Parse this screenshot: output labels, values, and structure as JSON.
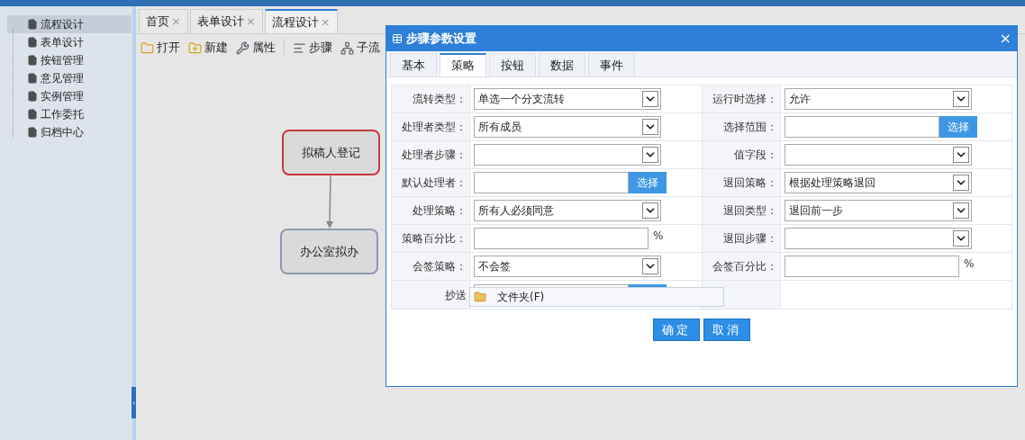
{
  "sidebar": {
    "items": [
      {
        "label": "流程设计",
        "selected": true
      },
      {
        "label": "表单设计",
        "selected": false
      },
      {
        "label": "按钮管理",
        "selected": false
      },
      {
        "label": "意见管理",
        "selected": false
      },
      {
        "label": "实例管理",
        "selected": false
      },
      {
        "label": "工作委托",
        "selected": false
      },
      {
        "label": "归档中心",
        "selected": false
      }
    ]
  },
  "tabs": [
    {
      "label": "首页",
      "close": "×",
      "selected": false
    },
    {
      "label": "表单设计",
      "close": "×",
      "selected": false
    },
    {
      "label": "流程设计",
      "close": "×",
      "selected": true
    }
  ],
  "toolbar": [
    {
      "kind": "open",
      "label": "打开"
    },
    {
      "kind": "new",
      "label": "新建"
    },
    {
      "kind": "tools",
      "label": "属性"
    },
    {
      "kind": "separator"
    },
    {
      "kind": "step",
      "label": "步骤"
    },
    {
      "kind": "subflow",
      "label": "子流"
    }
  ],
  "canvas": {
    "nodes": [
      {
        "label": "拟稿人登记",
        "kind": "start"
      },
      {
        "label": "办公室拟办",
        "kind": "task"
      }
    ]
  },
  "dialog": {
    "title": "步骤参数设置",
    "close": "×",
    "tabs": [
      {
        "label": "基本",
        "selected": false
      },
      {
        "label": "策略",
        "selected": true
      },
      {
        "label": "按钮",
        "selected": false
      },
      {
        "label": "数据",
        "selected": false
      },
      {
        "label": "事件",
        "selected": false
      }
    ],
    "rows": [
      [
        {
          "label": "流转类型：",
          "kind": "select",
          "value": "单选一个分支流转"
        },
        {
          "label": "运行时选择：",
          "kind": "select",
          "value": "允许"
        }
      ],
      [
        {
          "label": "处理者类型：",
          "kind": "select",
          "value": "所有成员"
        },
        {
          "label": "选择范围：",
          "kind": "pick",
          "button": "选择"
        }
      ],
      [
        {
          "label": "处理者步骤：",
          "kind": "select"
        },
        {
          "label": "值字段：",
          "kind": "select"
        }
      ],
      [
        {
          "label": "默认处理者：",
          "kind": "pick",
          "button": "选择"
        },
        {
          "label": "退回策略：",
          "kind": "select",
          "value": "根据处理策略退回"
        }
      ],
      [
        {
          "label": "处理策略：",
          "kind": "select",
          "value": "所有人必须同意"
        },
        {
          "label": "退回类型：",
          "kind": "select",
          "value": "退回前一步"
        }
      ],
      [
        {
          "label": "策略百分比：",
          "kind": "percent",
          "unit": "%"
        },
        {
          "label": "退回步骤：",
          "kind": "select"
        }
      ],
      [
        {
          "label": "会签策略：",
          "kind": "select",
          "value": "不会签"
        },
        {
          "label": "会签百分比：",
          "kind": "percent",
          "unit": "%"
        }
      ],
      [
        {
          "label": "抄送",
          "kind": "pick"
        }
      ]
    ],
    "popup": {
      "label": "文件夹(F)"
    },
    "buttons": [
      "确定",
      "取消"
    ]
  }
}
